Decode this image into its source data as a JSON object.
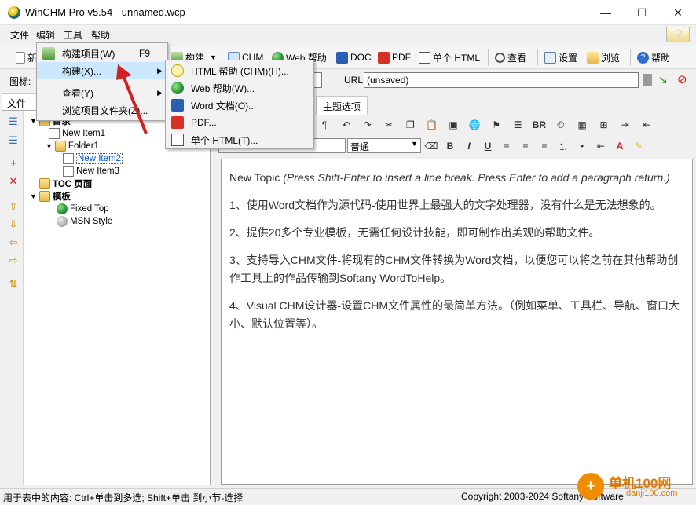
{
  "window": {
    "title": "WinCHM Pro v5.54  -  unnamed.wcp",
    "minimize": "—",
    "maximize": "☐",
    "close": "✕"
  },
  "menubar": [
    "文件",
    "编辑",
    "工具",
    "帮助"
  ],
  "toolbar": {
    "new_label": "新",
    "build_label": "构建",
    "chm_label": "CHM",
    "web_label": "Web 帮助",
    "doc_label": "DOC",
    "pdf_label": "PDF",
    "single_html_label": "单个 HTML",
    "view_label": "查看",
    "settings_label": "设置",
    "browse_label": "浏览",
    "help_label": "帮助"
  },
  "iconbar": {
    "icon_label": "图标:",
    "url_label": "URL:",
    "url_value": "(unsaved)"
  },
  "left_tab": "文件列",
  "tree": [
    {
      "label": "目录",
      "icon": "folder-icon",
      "level": 0,
      "bold": true
    },
    {
      "label": "New Item1",
      "icon": "page-icon",
      "level": 2
    },
    {
      "label": "Folder1",
      "icon": "folder-icon",
      "level": 1
    },
    {
      "label": "New Item2",
      "icon": "page-icon",
      "level": 2,
      "selected": true
    },
    {
      "label": "New Item3",
      "icon": "page-icon",
      "level": 2
    },
    {
      "label": "TOC 页面",
      "icon": "folder-icon",
      "level": 0,
      "bold": true
    },
    {
      "label": "模板",
      "icon": "folder-icon",
      "level": 0,
      "bold": true
    },
    {
      "label": "Fixed Top",
      "icon": "globe-icon",
      "level": 1
    },
    {
      "label": "MSN Style",
      "icon": "gray-globe-icon",
      "level": 1
    }
  ],
  "right_tab": "主题选项",
  "style_select": "普通",
  "editor": {
    "heading": "New Topic",
    "hint": "(Press Shift-Enter to insert a line break. Press Enter to add a paragraph return.)",
    "paragraphs": [
      "1、使用Word文档作为源代码-使用世界上最强大的文字处理器，没有什么是无法想象的。",
      "2、提供20多个专业模板，无需任何设计技能，即可制作出美观的帮助文件。",
      "3、支持导入CHM文件-将现有的CHM文件转换为Word文档，以便您可以将之前在其他帮助创作工具上的作品传输到Softany WordToHelp。",
      "4、Visual CHM设计器-设置CHM文件属性的最简单方法。（例如菜单、工具栏、导航、窗口大小、默认位置等）。"
    ]
  },
  "tools_menu": {
    "items": [
      {
        "label": "构建项目(W)",
        "key": "F9"
      },
      {
        "label": "构建(X)...",
        "arrow": "▶"
      },
      {
        "label": "查看(Y)",
        "arrow": "▶"
      },
      {
        "label": "浏览项目文件夹(Z)..."
      }
    ]
  },
  "build_submenu": {
    "items": [
      {
        "label": "HTML 帮助 (CHM)(H)..."
      },
      {
        "label": "Web 帮助(W)..."
      },
      {
        "label": "Word 文档(O)..."
      },
      {
        "label": "PDF..."
      },
      {
        "label": "单个 HTML(T)..."
      }
    ]
  },
  "status": {
    "left": "用于表中的内容: Ctrl+单击到多选; Shift+单击 到小节-选择",
    "right": "Copyright 2003-2024 Softany Software"
  },
  "watermark": {
    "brand": "单机100网",
    "url": "danji100.com"
  },
  "colors": {
    "accent_red_arrow": "#d32020",
    "menu_highlight": "#cce8ff",
    "selected_tree_text": "#0052cc"
  }
}
